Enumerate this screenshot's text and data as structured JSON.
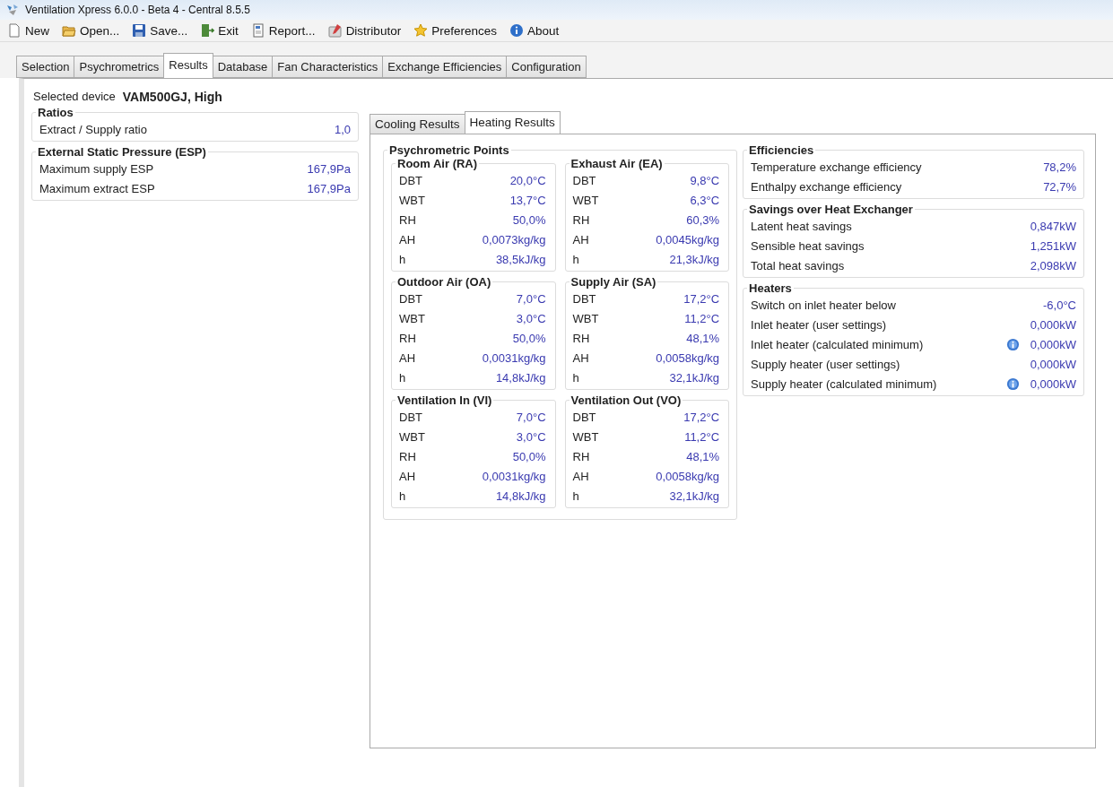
{
  "window": {
    "title": "Ventilation Xpress 6.0.0 - Beta 4 - Central 8.5.5"
  },
  "toolbar": [
    {
      "label": "New",
      "kind": "new"
    },
    {
      "label": "Open...",
      "kind": "open"
    },
    {
      "label": "Save...",
      "kind": "save"
    },
    {
      "label": "Exit",
      "kind": "exit"
    },
    {
      "label": "Report...",
      "kind": "report"
    },
    {
      "label": "Distributor",
      "kind": "distributor"
    },
    {
      "label": "Preferences",
      "kind": "preferences"
    },
    {
      "label": "About",
      "kind": "about"
    }
  ],
  "tabs": [
    {
      "label": "Selection",
      "selected": false
    },
    {
      "label": "Psychrometrics",
      "selected": false
    },
    {
      "label": "Results",
      "selected": true
    },
    {
      "label": "Database",
      "selected": false
    },
    {
      "label": "Fan Characteristics",
      "selected": false
    },
    {
      "label": "Exchange Efficiencies",
      "selected": false
    },
    {
      "label": "Configuration",
      "selected": false
    }
  ],
  "selected_device": {
    "label": "Selected device",
    "value": "VAM500GJ, High"
  },
  "left_groups": [
    {
      "title": "Ratios",
      "rows": [
        {
          "label": "Extract / Supply ratio",
          "value": "1,0"
        }
      ]
    },
    {
      "title": "External Static Pressure (ESP)",
      "rows": [
        {
          "label": "Maximum supply ESP",
          "value": "167,9Pa"
        },
        {
          "label": "Maximum extract ESP",
          "value": "167,9Pa"
        }
      ]
    }
  ],
  "result_tabs": [
    {
      "label": "Cooling Results",
      "selected": false
    },
    {
      "label": "Heating Results",
      "selected": true
    }
  ],
  "psychrometric_points": {
    "title": "Psychrometric Points",
    "groups": [
      {
        "title": "Room Air (RA)",
        "rows": [
          {
            "label": "DBT",
            "value": "20,0°C"
          },
          {
            "label": "WBT",
            "value": "13,7°C"
          },
          {
            "label": "RH",
            "value": "50,0%"
          },
          {
            "label": "AH",
            "value": "0,0073kg/kg"
          },
          {
            "label": "h",
            "value": "38,5kJ/kg"
          }
        ]
      },
      {
        "title": "Exhaust Air (EA)",
        "rows": [
          {
            "label": "DBT",
            "value": "9,8°C"
          },
          {
            "label": "WBT",
            "value": "6,3°C"
          },
          {
            "label": "RH",
            "value": "60,3%"
          },
          {
            "label": "AH",
            "value": "0,0045kg/kg"
          },
          {
            "label": "h",
            "value": "21,3kJ/kg"
          }
        ]
      },
      {
        "title": "Outdoor Air (OA)",
        "rows": [
          {
            "label": "DBT",
            "value": "7,0°C"
          },
          {
            "label": "WBT",
            "value": "3,0°C"
          },
          {
            "label": "RH",
            "value": "50,0%"
          },
          {
            "label": "AH",
            "value": "0,0031kg/kg"
          },
          {
            "label": "h",
            "value": "14,8kJ/kg"
          }
        ]
      },
      {
        "title": "Supply Air (SA)",
        "rows": [
          {
            "label": "DBT",
            "value": "17,2°C"
          },
          {
            "label": "WBT",
            "value": "11,2°C"
          },
          {
            "label": "RH",
            "value": "48,1%"
          },
          {
            "label": "AH",
            "value": "0,0058kg/kg"
          },
          {
            "label": "h",
            "value": "32,1kJ/kg"
          }
        ]
      },
      {
        "title": "Ventilation In (VI)",
        "rows": [
          {
            "label": "DBT",
            "value": "7,0°C"
          },
          {
            "label": "WBT",
            "value": "3,0°C"
          },
          {
            "label": "RH",
            "value": "50,0%"
          },
          {
            "label": "AH",
            "value": "0,0031kg/kg"
          },
          {
            "label": "h",
            "value": "14,8kJ/kg"
          }
        ]
      },
      {
        "title": "Ventilation Out (VO)",
        "rows": [
          {
            "label": "DBT",
            "value": "17,2°C"
          },
          {
            "label": "WBT",
            "value": "11,2°C"
          },
          {
            "label": "RH",
            "value": "48,1%"
          },
          {
            "label": "AH",
            "value": "0,0058kg/kg"
          },
          {
            "label": "h",
            "value": "32,1kJ/kg"
          }
        ]
      }
    ]
  },
  "right_groups": [
    {
      "title": "Efficiencies",
      "rows": [
        {
          "label": "Temperature exchange efficiency",
          "value": "78,2%",
          "info": false
        },
        {
          "label": "Enthalpy exchange efficiency",
          "value": "72,7%",
          "info": false
        }
      ]
    },
    {
      "title": "Savings over Heat Exchanger",
      "rows": [
        {
          "label": "Latent heat savings",
          "value": "0,847kW",
          "info": false
        },
        {
          "label": "Sensible heat savings",
          "value": "1,251kW",
          "info": false
        },
        {
          "label": "Total heat savings",
          "value": "2,098kW",
          "info": false
        }
      ]
    },
    {
      "title": "Heaters",
      "rows": [
        {
          "label": "Switch on inlet heater below",
          "value": "-6,0°C",
          "info": false
        },
        {
          "label": "Inlet heater (user settings)",
          "value": "0,000kW",
          "info": false
        },
        {
          "label": "Inlet heater (calculated minimum)",
          "value": "0,000kW",
          "info": true
        },
        {
          "label": "Supply heater (user settings)",
          "value": "0,000kW",
          "info": false
        },
        {
          "label": "Supply heater (calculated minimum)",
          "value": "0,000kW",
          "info": true
        }
      ]
    }
  ]
}
